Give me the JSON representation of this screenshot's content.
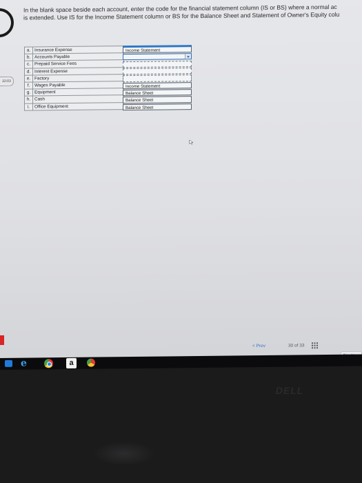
{
  "question": {
    "line1": "In the blank space beside each account, enter the code for the financial statement column (IS or BS) where a normal ac",
    "line2": "is extended. Use IS for the Income Statement column or BS for the Balance Sheet and Statement of Owner's Equity colu"
  },
  "timer": "22:03",
  "accounts": [
    {
      "letter": "a.",
      "name": "Insurance Expense"
    },
    {
      "letter": "b.",
      "name": "Accounts Payable"
    },
    {
      "letter": "c.",
      "name": "Prepaid Service Fees"
    },
    {
      "letter": "d.",
      "name": "Interest Expense"
    },
    {
      "letter": "e.",
      "name": "Factory"
    },
    {
      "letter": "f.",
      "name": "Wages Payable"
    },
    {
      "letter": "g.",
      "name": "Equipment"
    },
    {
      "letter": "h.",
      "name": "Cash"
    },
    {
      "letter": "i.",
      "name": "Office Equipment"
    }
  ],
  "answers": [
    "Income Statement",
    "",
    "",
    "",
    "",
    "Income Statement",
    "Balance Sheet",
    "Balance Sheet",
    "Balance Sheet"
  ],
  "nav": {
    "prev": "< Prev",
    "page": "30 of 33",
    "next": "Next >"
  },
  "taskbar": {
    "amazon_label": "a"
  },
  "icons": {
    "store": "store-icon",
    "ie": "internet-explorer-icon",
    "chrome": "chrome-icon",
    "amazon": "amazon-icon",
    "grid": "grid-icon",
    "cursor": "mouse-cursor-icon"
  },
  "colors": {
    "accent": "#2e78c6",
    "taskbar": "#0b0b0d",
    "error_tab": "#d92525"
  },
  "bezel_logo": "DELL"
}
